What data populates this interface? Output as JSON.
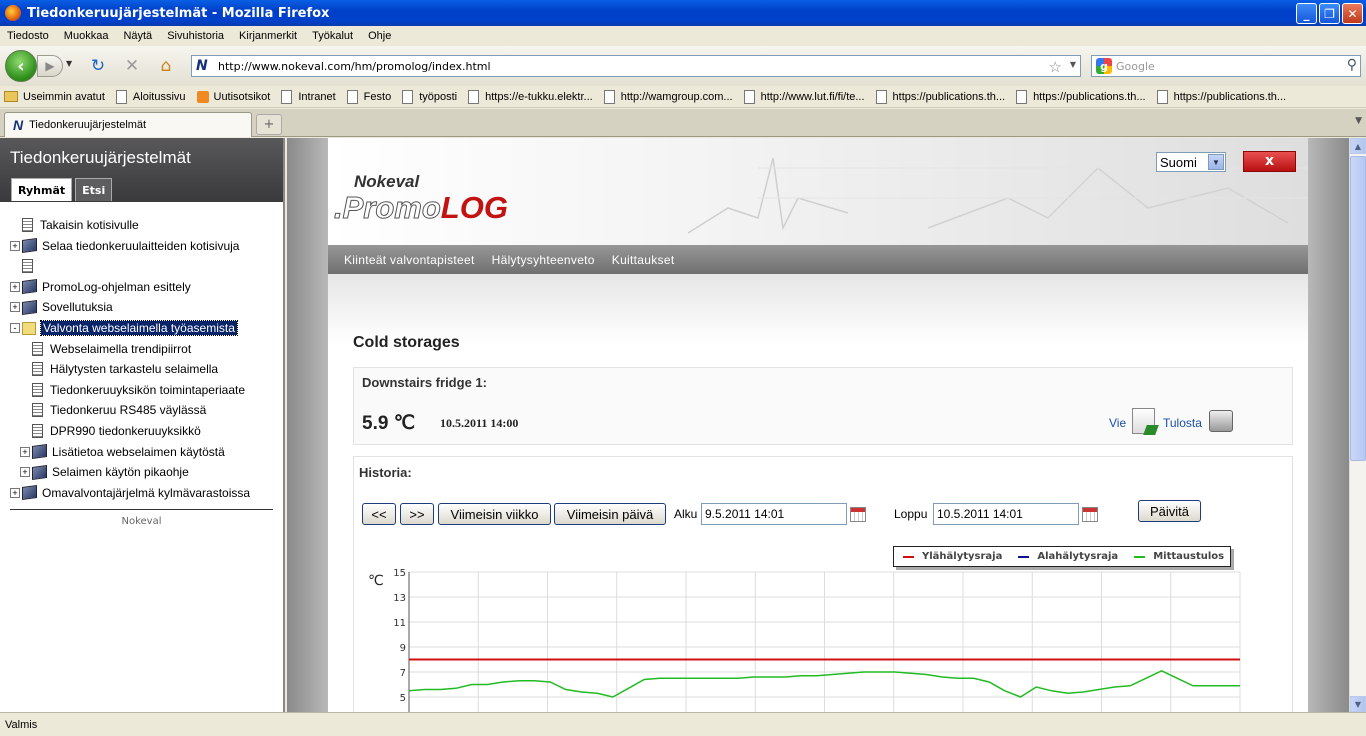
{
  "window": {
    "title": "Tiedonkeruujärjestelmät - Mozilla Firefox"
  },
  "menu": [
    "Tiedosto",
    "Muokkaa",
    "Näytä",
    "Sivuhistoria",
    "Kirjanmerkit",
    "Työkalut",
    "Ohje"
  ],
  "address": {
    "url": "http://www.nokeval.com/hm/promolog/index.html"
  },
  "search": {
    "placeholder": "Google"
  },
  "bookmarks": [
    "Useimmin avatut",
    "Aloitussivu",
    "Uutisotsikot",
    "Intranet",
    "Festo",
    "työposti",
    "https://e-tukku.elektr...",
    "http://wamgroup.com...",
    "http://www.lut.fi/fi/te...",
    "https://publications.th...",
    "https://publications.th...",
    "https://publications.th..."
  ],
  "tab": {
    "title": "Tiedonkeruujärjestelmät"
  },
  "sidebar": {
    "title": "Tiedonkeruujärjestelmät",
    "tabs": [
      "Ryhmät",
      "Etsi"
    ],
    "tree": [
      {
        "label": "Takaisin kotisivulle",
        "icon": "doc",
        "indent": 0,
        "toggle": ""
      },
      {
        "label": "Selaa tiedonkeruulaitteiden kotisivuja",
        "icon": "book",
        "indent": 0,
        "toggle": "+"
      },
      {
        "label": "",
        "icon": "doc",
        "indent": 0,
        "toggle": ""
      },
      {
        "label": "PromoLog-ohjelman esittely",
        "icon": "book",
        "indent": 0,
        "toggle": "+"
      },
      {
        "label": "Sovellutuksia",
        "icon": "book",
        "indent": 0,
        "toggle": "+"
      },
      {
        "label": "Valvonta webselaimella työasemista",
        "icon": "openfolder",
        "indent": 0,
        "toggle": "-",
        "selected": true
      },
      {
        "label": "Webselaimella trendipiirrot",
        "icon": "doc",
        "indent": 1,
        "toggle": ""
      },
      {
        "label": "Hälytysten tarkastelu selaimella",
        "icon": "doc",
        "indent": 1,
        "toggle": ""
      },
      {
        "label": "Tiedonkeruuyksikön toimintaperiaate",
        "icon": "doc",
        "indent": 1,
        "toggle": ""
      },
      {
        "label": "Tiedonkeruu RS485 väylässä",
        "icon": "doc",
        "indent": 1,
        "toggle": ""
      },
      {
        "label": "DPR990 tiedonkeruuyksikkö",
        "icon": "doc",
        "indent": 1,
        "toggle": ""
      },
      {
        "label": "Lisätietoa webselaimen käytöstä",
        "icon": "book",
        "indent": 1,
        "toggle": "+"
      },
      {
        "label": "Selaimen käytön pikaohje",
        "icon": "book",
        "indent": 1,
        "toggle": "+"
      },
      {
        "label": "Omavalvontajärjelmä kylmävarastoissa",
        "icon": "book",
        "indent": 0,
        "toggle": "+"
      }
    ],
    "footer": "Nokeval"
  },
  "promolog": {
    "logo_top": "Nokeval",
    "logo_main_a": ".Promo",
    "logo_main_b": "LOG",
    "language": "Suomi",
    "close": "x",
    "nav": [
      "Kiinteät valvontapisteet",
      "Hälytysyhteenveto",
      "Kuittaukset"
    ],
    "heading": "Cold storages",
    "fridge": {
      "name": "Downstairs fridge 1:",
      "temp": "5.9 ℃",
      "time": "10.5.2011 14:00",
      "export": "Vie",
      "print": "Tulosta"
    },
    "history": {
      "title": "Historia:",
      "prev": "<<",
      "next": ">>",
      "last_week": "Viimeisin viikko",
      "last_day": "Viimeisin päivä",
      "start_label": "Alku",
      "start_value": "9.5.2011 14:01",
      "end_label": "Loppu",
      "end_value": "10.5.2011 14:01",
      "refresh": "Päivitä"
    }
  },
  "chart_data": {
    "type": "line",
    "ylabel": "℃",
    "ylim": [
      4,
      15
    ],
    "yticks": [
      5,
      7,
      9,
      11,
      13,
      15
    ],
    "grid": true,
    "legend_position": "top-right",
    "series": [
      {
        "name": "Ylähälytysraja",
        "color": "#d01010",
        "values": [
          8,
          8,
          8,
          8,
          8,
          8,
          8,
          8,
          8,
          8,
          8,
          8,
          8,
          8,
          8,
          8,
          8,
          8,
          8,
          8,
          8,
          8,
          8,
          8,
          8,
          8,
          8,
          8,
          8,
          8,
          8,
          8,
          8,
          8,
          8,
          8,
          8,
          8,
          8,
          8,
          8,
          8,
          8,
          8,
          8,
          8,
          8,
          8,
          8,
          8,
          8,
          8,
          8,
          8
        ]
      },
      {
        "name": "Alahälytysraja",
        "color": "#101090",
        "values": []
      },
      {
        "name": "Mittaustulos",
        "color": "#22bb22",
        "values": [
          5.5,
          5.6,
          5.6,
          5.7,
          6.0,
          6.0,
          6.2,
          6.3,
          6.3,
          6.2,
          5.6,
          5.4,
          5.3,
          5.0,
          5.7,
          6.4,
          6.5,
          6.5,
          6.5,
          6.5,
          6.5,
          6.5,
          6.6,
          6.6,
          6.6,
          6.7,
          6.7,
          6.8,
          6.9,
          7.0,
          7.0,
          7.0,
          6.9,
          6.8,
          6.6,
          6.5,
          6.5,
          6.2,
          5.5,
          5.0,
          5.8,
          5.5,
          5.3,
          5.4,
          5.6,
          5.8,
          5.9,
          6.5,
          7.1,
          6.5,
          5.9,
          5.9,
          5.9,
          5.9
        ]
      }
    ]
  },
  "status": "Valmis"
}
